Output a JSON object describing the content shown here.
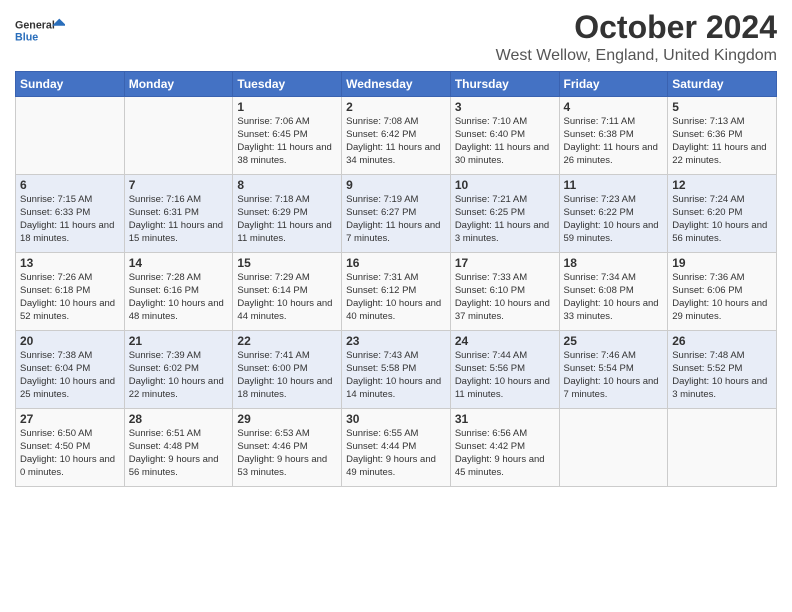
{
  "logo": {
    "text_general": "General",
    "text_blue": "Blue"
  },
  "title": "October 2024",
  "location": "West Wellow, England, United Kingdom",
  "days_of_week": [
    "Sunday",
    "Monday",
    "Tuesday",
    "Wednesday",
    "Thursday",
    "Friday",
    "Saturday"
  ],
  "weeks": [
    [
      {
        "day": "",
        "content": ""
      },
      {
        "day": "",
        "content": ""
      },
      {
        "day": "1",
        "content": "Sunrise: 7:06 AM\nSunset: 6:45 PM\nDaylight: 11 hours and 38 minutes."
      },
      {
        "day": "2",
        "content": "Sunrise: 7:08 AM\nSunset: 6:42 PM\nDaylight: 11 hours and 34 minutes."
      },
      {
        "day": "3",
        "content": "Sunrise: 7:10 AM\nSunset: 6:40 PM\nDaylight: 11 hours and 30 minutes."
      },
      {
        "day": "4",
        "content": "Sunrise: 7:11 AM\nSunset: 6:38 PM\nDaylight: 11 hours and 26 minutes."
      },
      {
        "day": "5",
        "content": "Sunrise: 7:13 AM\nSunset: 6:36 PM\nDaylight: 11 hours and 22 minutes."
      }
    ],
    [
      {
        "day": "6",
        "content": "Sunrise: 7:15 AM\nSunset: 6:33 PM\nDaylight: 11 hours and 18 minutes."
      },
      {
        "day": "7",
        "content": "Sunrise: 7:16 AM\nSunset: 6:31 PM\nDaylight: 11 hours and 15 minutes."
      },
      {
        "day": "8",
        "content": "Sunrise: 7:18 AM\nSunset: 6:29 PM\nDaylight: 11 hours and 11 minutes."
      },
      {
        "day": "9",
        "content": "Sunrise: 7:19 AM\nSunset: 6:27 PM\nDaylight: 11 hours and 7 minutes."
      },
      {
        "day": "10",
        "content": "Sunrise: 7:21 AM\nSunset: 6:25 PM\nDaylight: 11 hours and 3 minutes."
      },
      {
        "day": "11",
        "content": "Sunrise: 7:23 AM\nSunset: 6:22 PM\nDaylight: 10 hours and 59 minutes."
      },
      {
        "day": "12",
        "content": "Sunrise: 7:24 AM\nSunset: 6:20 PM\nDaylight: 10 hours and 56 minutes."
      }
    ],
    [
      {
        "day": "13",
        "content": "Sunrise: 7:26 AM\nSunset: 6:18 PM\nDaylight: 10 hours and 52 minutes."
      },
      {
        "day": "14",
        "content": "Sunrise: 7:28 AM\nSunset: 6:16 PM\nDaylight: 10 hours and 48 minutes."
      },
      {
        "day": "15",
        "content": "Sunrise: 7:29 AM\nSunset: 6:14 PM\nDaylight: 10 hours and 44 minutes."
      },
      {
        "day": "16",
        "content": "Sunrise: 7:31 AM\nSunset: 6:12 PM\nDaylight: 10 hours and 40 minutes."
      },
      {
        "day": "17",
        "content": "Sunrise: 7:33 AM\nSunset: 6:10 PM\nDaylight: 10 hours and 37 minutes."
      },
      {
        "day": "18",
        "content": "Sunrise: 7:34 AM\nSunset: 6:08 PM\nDaylight: 10 hours and 33 minutes."
      },
      {
        "day": "19",
        "content": "Sunrise: 7:36 AM\nSunset: 6:06 PM\nDaylight: 10 hours and 29 minutes."
      }
    ],
    [
      {
        "day": "20",
        "content": "Sunrise: 7:38 AM\nSunset: 6:04 PM\nDaylight: 10 hours and 25 minutes."
      },
      {
        "day": "21",
        "content": "Sunrise: 7:39 AM\nSunset: 6:02 PM\nDaylight: 10 hours and 22 minutes."
      },
      {
        "day": "22",
        "content": "Sunrise: 7:41 AM\nSunset: 6:00 PM\nDaylight: 10 hours and 18 minutes."
      },
      {
        "day": "23",
        "content": "Sunrise: 7:43 AM\nSunset: 5:58 PM\nDaylight: 10 hours and 14 minutes."
      },
      {
        "day": "24",
        "content": "Sunrise: 7:44 AM\nSunset: 5:56 PM\nDaylight: 10 hours and 11 minutes."
      },
      {
        "day": "25",
        "content": "Sunrise: 7:46 AM\nSunset: 5:54 PM\nDaylight: 10 hours and 7 minutes."
      },
      {
        "day": "26",
        "content": "Sunrise: 7:48 AM\nSunset: 5:52 PM\nDaylight: 10 hours and 3 minutes."
      }
    ],
    [
      {
        "day": "27",
        "content": "Sunrise: 6:50 AM\nSunset: 4:50 PM\nDaylight: 10 hours and 0 minutes."
      },
      {
        "day": "28",
        "content": "Sunrise: 6:51 AM\nSunset: 4:48 PM\nDaylight: 9 hours and 56 minutes."
      },
      {
        "day": "29",
        "content": "Sunrise: 6:53 AM\nSunset: 4:46 PM\nDaylight: 9 hours and 53 minutes."
      },
      {
        "day": "30",
        "content": "Sunrise: 6:55 AM\nSunset: 4:44 PM\nDaylight: 9 hours and 49 minutes."
      },
      {
        "day": "31",
        "content": "Sunrise: 6:56 AM\nSunset: 4:42 PM\nDaylight: 9 hours and 45 minutes."
      },
      {
        "day": "",
        "content": ""
      },
      {
        "day": "",
        "content": ""
      }
    ]
  ]
}
